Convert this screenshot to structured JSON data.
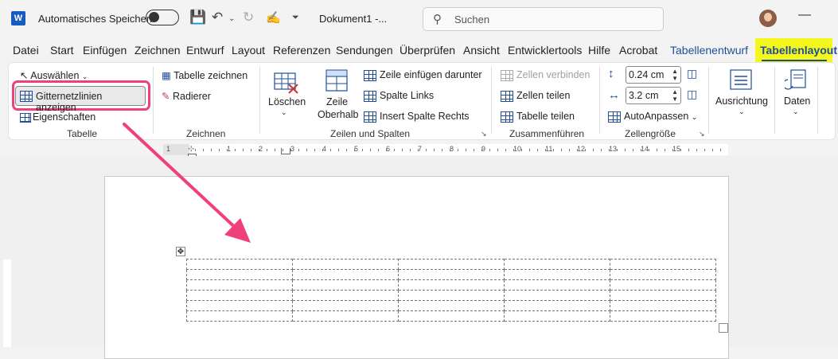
{
  "titlebar": {
    "app_icon": "W",
    "autosave_label": "Automatisches Speichern",
    "doc_name": "Dokument1  -...",
    "search_placeholder": "Suchen"
  },
  "tabs": [
    {
      "label": "Datei"
    },
    {
      "label": "Start"
    },
    {
      "label": "Einfügen"
    },
    {
      "label": "Zeichnen"
    },
    {
      "label": "Entwurf"
    },
    {
      "label": "Layout"
    },
    {
      "label": "Referenzen"
    },
    {
      "label": "Sendungen"
    },
    {
      "label": "Überprüfen"
    },
    {
      "label": "Ansicht"
    },
    {
      "label": "Entwicklertools"
    },
    {
      "label": "Hilfe"
    },
    {
      "label": "Acrobat"
    },
    {
      "label": "Tabellenentwurf"
    },
    {
      "label": "Tabellenlayout",
      "active": true
    }
  ],
  "ribbon": {
    "tabelle": {
      "auswaehlen": "Auswählen",
      "gitternetzlinien": "Gitternetzlinien anzeigen",
      "eigenschaften": "Eigenschaften",
      "label": "Tabelle"
    },
    "zeichnen": {
      "tabelle_zeichnen": "Tabelle zeichnen",
      "radierer": "Radierer",
      "label": "Zeichnen"
    },
    "zeilen_spalten": {
      "loeschen": "Löschen",
      "zeile_oberhalb_1": "Zeile",
      "zeile_oberhalb_2": "Oberhalb",
      "zeile_darunter": "Zeile einfügen darunter",
      "spalte_links": "Spalte Links",
      "spalte_rechts": "Insert Spalte Rechts",
      "label": "Zeilen und Spalten"
    },
    "zusammenfuehren": {
      "zellen_verbinden": "Zellen verbinden",
      "zellen_teilen": "Zellen teilen",
      "tabelle_teilen": "Tabelle teilen",
      "label": "Zusammenführen"
    },
    "zellengroesse": {
      "height": "0.24 cm",
      "width": "3.2 cm",
      "autoanpassen": "AutoAnpassen",
      "label": "Zellengröße"
    },
    "ausrichtung": "Ausrichtung",
    "daten": "Daten"
  },
  "ruler_numbers": [
    "1",
    "1",
    "2",
    "3",
    "4",
    "5",
    "6",
    "7",
    "8",
    "9",
    "10",
    "11",
    "12",
    "13",
    "14",
    "15"
  ],
  "annotation_color": "#f0407a",
  "highlight_color": "#f3f71d"
}
